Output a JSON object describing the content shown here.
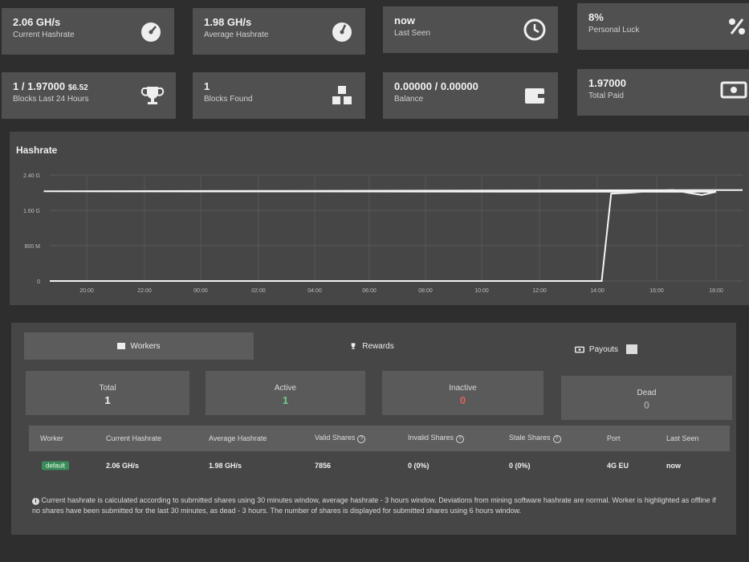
{
  "cards": [
    {
      "value": "2.06 GH/s",
      "label": "Current Hashrate",
      "icon": "speedometer-icon"
    },
    {
      "value": "1.98 GH/s",
      "label": "Average Hashrate",
      "icon": "speedometer-icon"
    },
    {
      "value": "now",
      "label": "Last Seen",
      "icon": "clock-icon"
    },
    {
      "value": "8%",
      "label": "Personal Luck",
      "icon": "percent-icon"
    },
    {
      "value": "1 / 1.97000",
      "value_extra": "$6.52",
      "label": "Blocks Last 24 Hours",
      "icon": "trophy-icon"
    },
    {
      "value": "1",
      "label": "Blocks Found",
      "icon": "cubes-icon"
    },
    {
      "value": "0.00000 / 0.00000",
      "label": "Balance",
      "icon": "wallet-icon"
    },
    {
      "value": "1.97000",
      "label": "Total Paid",
      "icon": "money-bill-icon"
    }
  ],
  "chart": {
    "title": "Hashrate",
    "chart_data": {
      "type": "line",
      "x_ticks": [
        "20:00",
        "22:00",
        "00:00",
        "02:00",
        "04:00",
        "06:00",
        "08:00",
        "10:00",
        "12:00",
        "14:00",
        "16:00",
        "18:00"
      ],
      "y_ticks": [
        "2.40 G",
        "1.60 G",
        "800 M",
        "0"
      ],
      "ylim": [
        0,
        2.4
      ],
      "series": [
        {
          "x": [
            "19:00",
            "14:00",
            "14:20",
            "15:00",
            "16:00",
            "16:30",
            "17:00",
            "17:30",
            "18:00",
            "18:30",
            "19:00"
          ],
          "values": [
            0,
            0,
            1.98,
            2.0,
            2.05,
            2.06,
            2.0,
            1.95,
            2.02,
            2.03,
            2.06
          ]
        }
      ]
    }
  },
  "tabs": {
    "workers": "Workers",
    "rewards": "Rewards",
    "payouts": "Payouts"
  },
  "stats": [
    {
      "label": "Total",
      "value": "1",
      "color": "#f0f0f0"
    },
    {
      "label": "Active",
      "value": "1",
      "color": "#6fcf8f"
    },
    {
      "label": "Inactive",
      "value": "0",
      "color": "#e06060"
    },
    {
      "label": "Dead",
      "value": "0",
      "color": "#9a9a9a"
    }
  ],
  "table": {
    "headers": [
      "Worker",
      "Current Hashrate",
      "Average Hashrate",
      "Valid Shares",
      "Invalid Shares",
      "Stale Shares",
      "Port",
      "Last Seen"
    ],
    "row": [
      "default",
      "2.06 GH/s",
      "1.98 GH/s",
      "7856",
      "0 (0%)",
      "0 (0%)",
      "4G EU",
      "now"
    ]
  },
  "note": "Current hashrate is calculated according to submitted shares using 30 minutes window, average hashrate - 3 hours window. Deviations from mining software hashrate are normal. Worker is highlighted as offline if no shares have been submitted for the last 30 minutes, as dead - 3 hours. The number of shares is displayed for submitted shares using 6 hours window."
}
